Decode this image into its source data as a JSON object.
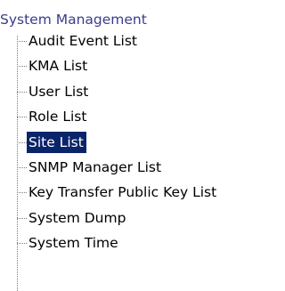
{
  "tree": {
    "root_label": "System Management",
    "items": [
      {
        "label": "Audit Event List",
        "selected": false
      },
      {
        "label": "KMA List",
        "selected": false
      },
      {
        "label": "User List",
        "selected": false
      },
      {
        "label": "Role List",
        "selected": false
      },
      {
        "label": "Site List",
        "selected": true
      },
      {
        "label": "SNMP Manager List",
        "selected": false
      },
      {
        "label": "Key Transfer Public Key List",
        "selected": false
      },
      {
        "label": "System Dump",
        "selected": false
      },
      {
        "label": "System Time",
        "selected": false
      }
    ]
  }
}
